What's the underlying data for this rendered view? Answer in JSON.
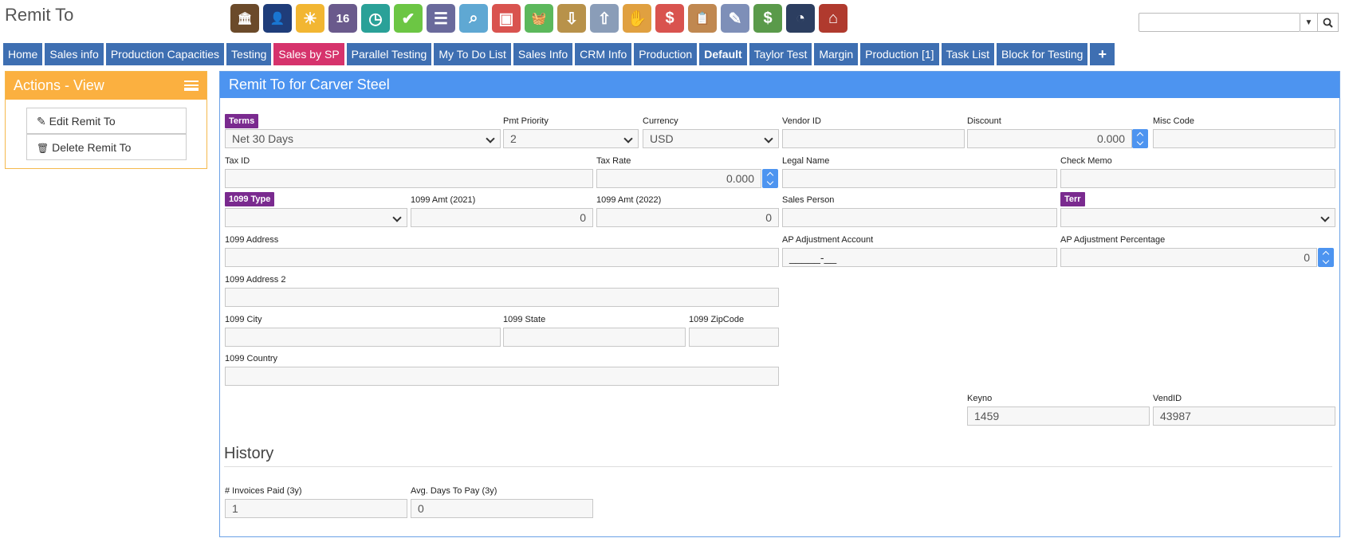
{
  "page": {
    "title": "Remit To"
  },
  "toolbar": {
    "icons": [
      {
        "name": "bank-icon",
        "color": "#6b4a2a",
        "glyph": "🏛"
      },
      {
        "name": "person-icon",
        "color": "#1f3d7a",
        "glyph": "👤"
      },
      {
        "name": "weather-icon",
        "color": "#f2b632",
        "glyph": "☀"
      },
      {
        "name": "calendar-icon",
        "color": "#6a5a8c",
        "glyph": "16"
      },
      {
        "name": "clock-icon",
        "color": "#2aa198",
        "glyph": "◷"
      },
      {
        "name": "checkmark-icon",
        "color": "#6cc644",
        "glyph": "✔"
      },
      {
        "name": "list-icon",
        "color": "#6a6a9c",
        "glyph": "☰"
      },
      {
        "name": "magnifier-icon",
        "color": "#5fa8d3",
        "glyph": "⌕"
      },
      {
        "name": "bus-icon",
        "color": "#d9534f",
        "glyph": "▣"
      },
      {
        "name": "basket-icon",
        "color": "#5cb85c",
        "glyph": "🧺"
      },
      {
        "name": "inbox-download-icon",
        "color": "#b8924a",
        "glyph": "⇩"
      },
      {
        "name": "inbox-upload-icon",
        "color": "#8a9db8",
        "glyph": "⇧"
      },
      {
        "name": "hand-card-icon",
        "color": "#e0a040",
        "glyph": "✋"
      },
      {
        "name": "dollar-chat-icon",
        "color": "#d9534f",
        "glyph": "$"
      },
      {
        "name": "clipboard-icon",
        "color": "#c08850",
        "glyph": "📋"
      },
      {
        "name": "eraser-icon",
        "color": "#7e8fb8",
        "glyph": "✎"
      },
      {
        "name": "money-icon",
        "color": "#5a9a4a",
        "glyph": "$"
      },
      {
        "name": "gauge-icon",
        "color": "#2c3e60",
        "glyph": "◔"
      },
      {
        "name": "factory-icon",
        "color": "#b03a2e",
        "glyph": "⌂"
      }
    ]
  },
  "search": {
    "placeholder": ""
  },
  "tabs": [
    "Home",
    "Sales info",
    "Production Capacities",
    "Testing",
    "Sales by SP",
    "Parallel Testing",
    "My To Do List",
    "Sales Info",
    "CRM Info",
    "Production",
    "Default",
    "Taylor Test",
    "Margin",
    "Production [1]",
    "Task List",
    "Block for Testing",
    "+"
  ],
  "actions": {
    "title": "Actions - View",
    "items": [
      "Edit Remit To",
      "Delete Remit To"
    ]
  },
  "main": {
    "title": "Remit To for Carver Steel"
  },
  "form": {
    "terms_label": "Terms",
    "terms_value": "Net 30 Days",
    "pmt_priority_label": "Pmt Priority",
    "pmt_priority_value": "2",
    "currency_label": "Currency",
    "currency_value": "USD",
    "vendor_id_label": "Vendor ID",
    "vendor_id_value": "",
    "discount_label": "Discount",
    "discount_value": "0.000",
    "misc_code_label": "Misc Code",
    "misc_code_value": "",
    "tax_id_label": "Tax ID",
    "tax_id_value": "",
    "tax_rate_label": "Tax Rate",
    "tax_rate_value": "0.000",
    "legal_name_label": "Legal Name",
    "legal_name_value": "",
    "check_memo_label": "Check Memo",
    "check_memo_value": "",
    "type1099_label": "1099 Type",
    "type1099_value": "",
    "amt2021_label": "1099 Amt (2021)",
    "amt2021_value": "0",
    "amt2022_label": "1099 Amt (2022)",
    "amt2022_value": "0",
    "sales_person_label": "Sales Person",
    "sales_person_value": "",
    "terr_label": "Terr",
    "terr_value": "",
    "address_label": "1099 Address",
    "address_value": "",
    "ap_account_label": "AP Adjustment Account",
    "ap_account_value": "_____-__",
    "ap_pct_label": "AP Adjustment Percentage",
    "ap_pct_value": "0",
    "address2_label": "1099 Address 2",
    "address2_value": "",
    "city_label": "1099 City",
    "city_value": "",
    "state_label": "1099 State",
    "state_value": "",
    "zip_label": "1099 ZipCode",
    "zip_value": "",
    "country_label": "1099 Country",
    "country_value": "",
    "keyno_label": "Keyno",
    "keyno_value": "1459",
    "vendid_label": "VendID",
    "vendid_value": "43987"
  },
  "history": {
    "title": "History",
    "invoices_label": "# Invoices Paid (3y)",
    "invoices_value": "1",
    "avg_days_label": "Avg. Days To Pay (3y)",
    "avg_days_value": "0"
  }
}
